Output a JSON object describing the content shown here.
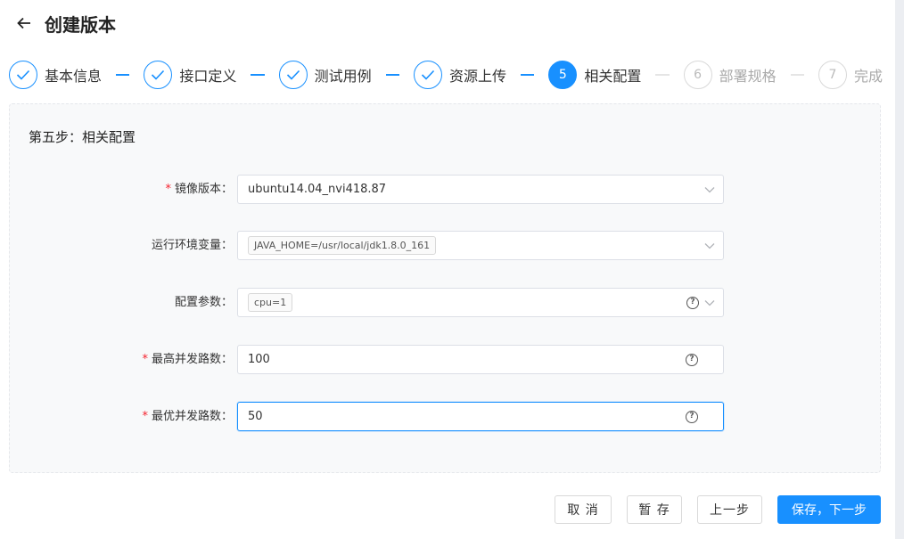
{
  "page": {
    "title": "创建版本"
  },
  "steps": [
    {
      "number": "1",
      "label": "基本信息",
      "state": "done"
    },
    {
      "number": "2",
      "label": "接口定义",
      "state": "done"
    },
    {
      "number": "3",
      "label": "测试用例",
      "state": "done"
    },
    {
      "number": "4",
      "label": "资源上传",
      "state": "done"
    },
    {
      "number": "5",
      "label": "相关配置",
      "state": "active"
    },
    {
      "number": "6",
      "label": "部署规格",
      "state": "todo"
    },
    {
      "number": "7",
      "label": "完成",
      "state": "todo"
    }
  ],
  "section": {
    "title": "第五步：相关配置"
  },
  "form": {
    "image_version": {
      "label": "镜像版本：",
      "required": true,
      "value": "ubuntu14.04_nvi418.87"
    },
    "env_vars": {
      "label": "运行环境变量：",
      "required": false,
      "tag": "JAVA_HOME=/usr/local/jdk1.8.0_161"
    },
    "config_params": {
      "label": "配置参数：",
      "required": false,
      "tag": "cpu=1"
    },
    "max_concurrency": {
      "label": "最高并发路数：",
      "required": true,
      "value": "100"
    },
    "optimal_concurrency": {
      "label": "最优并发路数：",
      "required": true,
      "value": "50"
    }
  },
  "footer": {
    "cancel_label": "取 消",
    "draft_label": "暂 存",
    "prev_label": "上一步",
    "next_label": "保存，下一步"
  },
  "colors": {
    "primary": "#1890ff",
    "required": "#f5222d"
  }
}
